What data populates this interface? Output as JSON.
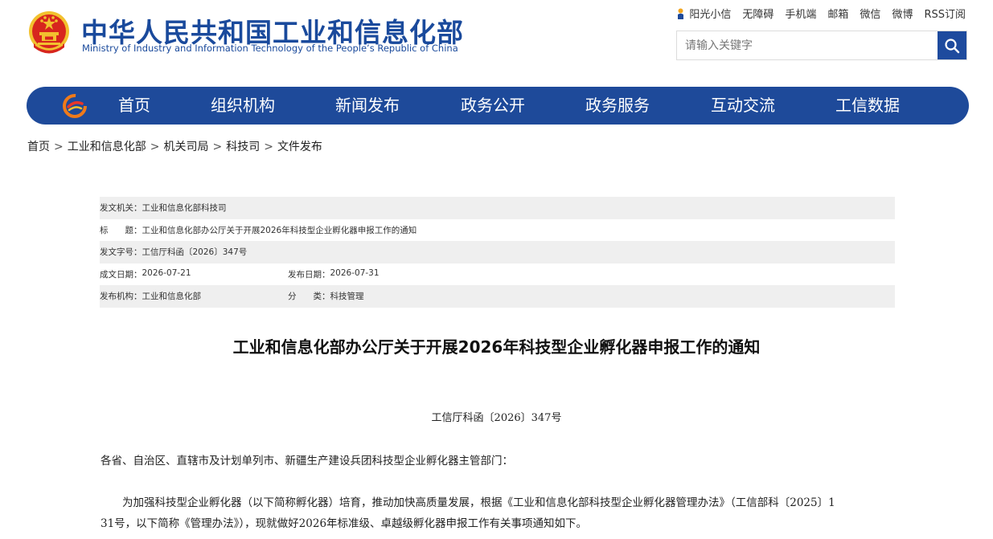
{
  "header": {
    "brand_cn": "中华人民共和国工业和信息化部",
    "brand_en": "Ministry of Industry and Information Technology of the People’s Republic of China",
    "top_links": [
      "阳光小信",
      "无障碍",
      "手机端",
      "邮箱",
      "微信",
      "微博",
      "RSS订阅"
    ],
    "search_placeholder": "请输入关键字"
  },
  "nav": {
    "items": [
      "首页",
      "组织机构",
      "新闻发布",
      "政务公开",
      "政务服务",
      "互动交流",
      "工信数据"
    ]
  },
  "breadcrumb": [
    "首页",
    "工业和信息化部",
    "机关司局",
    "科技司",
    "文件发布"
  ],
  "meta": {
    "issuer_label": "发文机关：",
    "issuer": "工业和信息化部科技司",
    "title_label": "标　　题：",
    "title": "工业和信息化部办公厅关于开展2026年科技型企业孵化器申报工作的通知",
    "doc_no_label": "发文字号：",
    "doc_no": "工信厅科函〔2026〕347号",
    "created_label": "成文日期：",
    "created": "2026-07-21",
    "published_label": "发布日期：",
    "published": "2026-07-31",
    "org_label": "发布机构：",
    "org": "工业和信息化部",
    "category_label": "分　　类：",
    "category": "科技管理"
  },
  "article": {
    "title": "工业和信息化部办公厅关于开展2026年科技型企业孵化器申报工作的通知",
    "doc_number": "工信厅科函〔2026〕347号",
    "paragraphs": [
      "各省、自治区、直辖市及计划单列市、新疆生产建设兵团科技型企业孵化器主管部门：",
      "为加强科技型企业孵化器（以下简称孵化器）培育，推动加快高质量发展，根据《工业和信息化部科技型企业孵化器管理办法》（工信部科〔2025〕1",
      "31号，以下简称《管理办法》），现就做好2026年标准级、卓越级孵化器申报工作有关事项通知如下。"
    ]
  },
  "colors": {
    "brand_blue": "#1a4a9c",
    "nav_blue": "#1e4a9a",
    "emblem_red": "#d7261e",
    "emblem_gold": "#f2c12e",
    "meta_row_shade": "#efefef"
  },
  "icons": {
    "emblem": "national-emblem-icon",
    "sun": "sun-person-icon",
    "search": "search-icon",
    "nav_logo": "site-logo-icon"
  }
}
